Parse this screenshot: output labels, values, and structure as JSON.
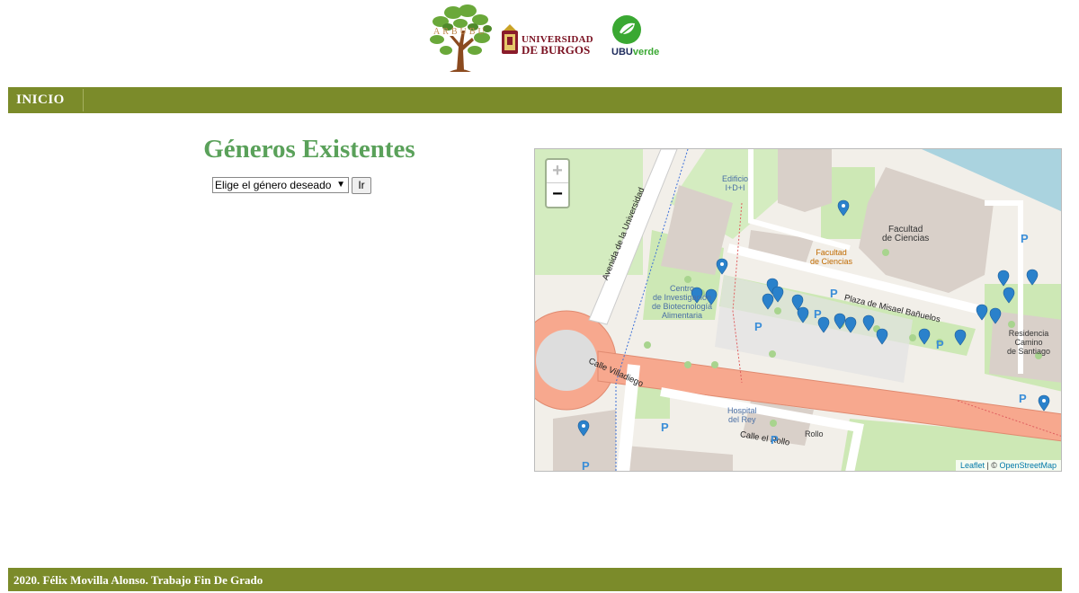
{
  "header": {
    "logos": {
      "arbubu": "ARBUBU",
      "ubu_line1": "UNIVERSIDAD",
      "ubu_line2": "DE BURGOS",
      "ubuverde_ubu": "UBU",
      "ubuverde_verde": "verde"
    }
  },
  "nav": {
    "home_label": "INICIO"
  },
  "main": {
    "title": "Géneros Existentes",
    "select_value": "Elige el género deseado",
    "go_label": "Ir"
  },
  "map": {
    "zoom_in": "+",
    "zoom_out": "−",
    "attribution_leaflet": "Leaflet",
    "attribution_sep": " | © ",
    "attribution_osm": "OpenStreetMap",
    "labels": {
      "edificio": "Edificio\nI+D+I",
      "facultad_bar": "Facultad\nde Ciencias",
      "facultad": "Facultad\nde Ciencias",
      "centro": "Centro\nde Investigación\nde Biotecnología\nAlimentaria",
      "residencia": "Residencia\nCamino\nde Santiago",
      "hospital": "Hospital\ndel Rey",
      "rollo": "Rollo",
      "plaza": "Plaza de Misael Bañuelos",
      "avenida": "Avenida de la Universidad",
      "villadiego": "Calle Villadiego",
      "el_rollo": "Calle el Rollo",
      "parking": "P"
    },
    "colors": {
      "grass": "#cde8b5",
      "building": "#d9d0c9",
      "road": "#f7a88e",
      "marker": "#2a81cb",
      "water": "#aad3df"
    }
  },
  "footer": {
    "text": "2020. Félix Movilla Alonso. Trabajo Fin De Grado"
  }
}
